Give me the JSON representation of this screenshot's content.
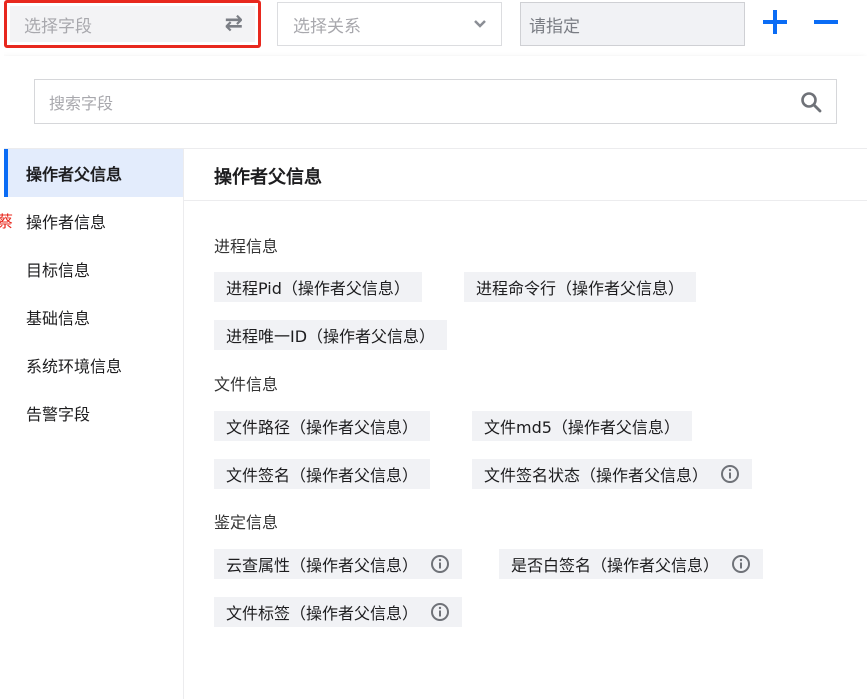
{
  "toolbar": {
    "field_placeholder": "选择字段",
    "relation_placeholder": "选择关系",
    "value_placeholder": "请指定"
  },
  "search": {
    "placeholder": "搜索字段"
  },
  "sidebar": {
    "items": [
      {
        "label": "操作者父信息"
      },
      {
        "label": "操作者信息"
      },
      {
        "label": "目标信息"
      },
      {
        "label": "基础信息"
      },
      {
        "label": "系统环境信息"
      },
      {
        "label": "告警字段"
      }
    ]
  },
  "content": {
    "title": "操作者父信息",
    "groups": [
      {
        "title": "进程信息",
        "fields": [
          {
            "label": "进程Pid（操作者父信息）",
            "info": false
          },
          {
            "label": "进程命令行（操作者父信息）",
            "info": false
          },
          {
            "label": "进程唯一ID（操作者父信息）",
            "info": false
          }
        ]
      },
      {
        "title": "文件信息",
        "fields": [
          {
            "label": "文件路径（操作者父信息）",
            "info": false
          },
          {
            "label": "文件md5（操作者父信息）",
            "info": false
          },
          {
            "label": "文件签名（操作者父信息）",
            "info": false
          },
          {
            "label": "文件签名状态（操作者父信息）",
            "info": true
          }
        ]
      },
      {
        "title": "鉴定信息",
        "fields": [
          {
            "label": "云查属性（操作者父信息）",
            "info": true
          },
          {
            "label": "是否白签名（操作者父信息）",
            "info": true
          },
          {
            "label": "文件标签（操作者父信息）",
            "info": true
          }
        ]
      }
    ]
  },
  "stray_mark": "蔡",
  "colors": {
    "accent": "#0a6cf5",
    "highlight_border": "#e8281e",
    "chip_bg": "#f1f2f5",
    "active_bg": "#e3ecfc"
  },
  "icons": {
    "swap": "swap-arrows-icon",
    "chevron": "chevron-down-icon",
    "add": "plus-icon",
    "remove": "minus-icon",
    "search": "search-icon",
    "info": "info-icon"
  }
}
